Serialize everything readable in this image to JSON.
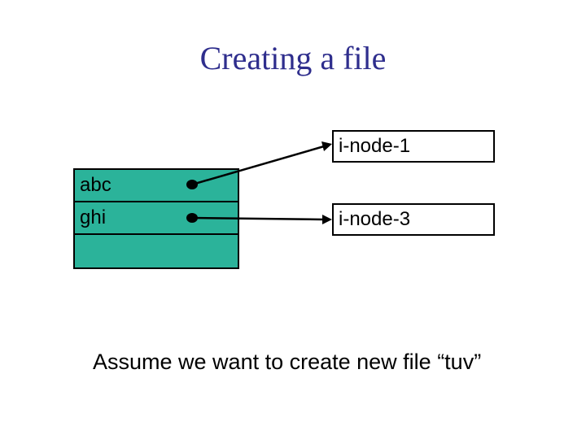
{
  "title": "Creating a file",
  "dir": {
    "rows": [
      "abc",
      "ghi",
      ""
    ]
  },
  "inodes": {
    "n1": "i-node-1",
    "n3": "i-node-3"
  },
  "caption": "Assume we want to create new file “tuv”",
  "chart_data": {
    "type": "table",
    "title": "Creating a file",
    "directory_entries": [
      {
        "name": "abc",
        "points_to": "i-node-1"
      },
      {
        "name": "ghi",
        "points_to": "i-node-3"
      },
      {
        "name": "",
        "points_to": null
      }
    ],
    "annotation": "Assume we want to create new file \"tuv\""
  }
}
